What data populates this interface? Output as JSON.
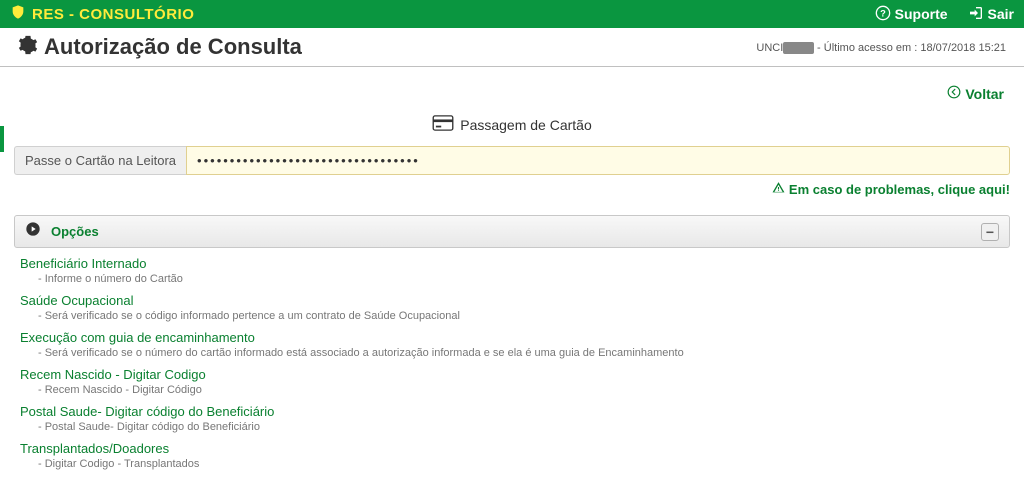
{
  "header": {
    "title": "RES - CONSULTÓRIO",
    "support": "Suporte",
    "logout": "Sair"
  },
  "subheader": {
    "page_title": "Autorização de Consulta",
    "last_access_prefix": "UNCI",
    "last_access_suffix": " - Último acesso em : 18/07/2018 15:21"
  },
  "back_label": "Voltar",
  "card": {
    "section_title": "Passagem de Cartão",
    "label": "Passe o Cartão na Leitora",
    "value": "••••••••••••••••••••••••••••••••••"
  },
  "problems_label": "Em caso de problemas, clique aqui!",
  "options": {
    "title": "Opções",
    "items": [
      {
        "title": "Beneficiário Internado",
        "desc": "- Informe o número do Cartão"
      },
      {
        "title": "Saúde Ocupacional",
        "desc": "- Será verificado se o código informado pertence a um contrato de Saúde Ocupacional"
      },
      {
        "title": "Execução com guia de encaminhamento",
        "desc": "- Será verificado se o número do cartão informado está associado a autorização informada e se ela é uma guia de Encaminhamento"
      },
      {
        "title": "Recem Nascido - Digitar Codigo",
        "desc": "- Recem Nascido - Digitar Código"
      },
      {
        "title": "Postal Saude- Digitar código do Beneficiário",
        "desc": "- Postal Saude- Digitar código do Beneficiário"
      },
      {
        "title": "Transplantados/Doadores",
        "desc": "- Digitar Codigo - Transplantados"
      }
    ]
  }
}
